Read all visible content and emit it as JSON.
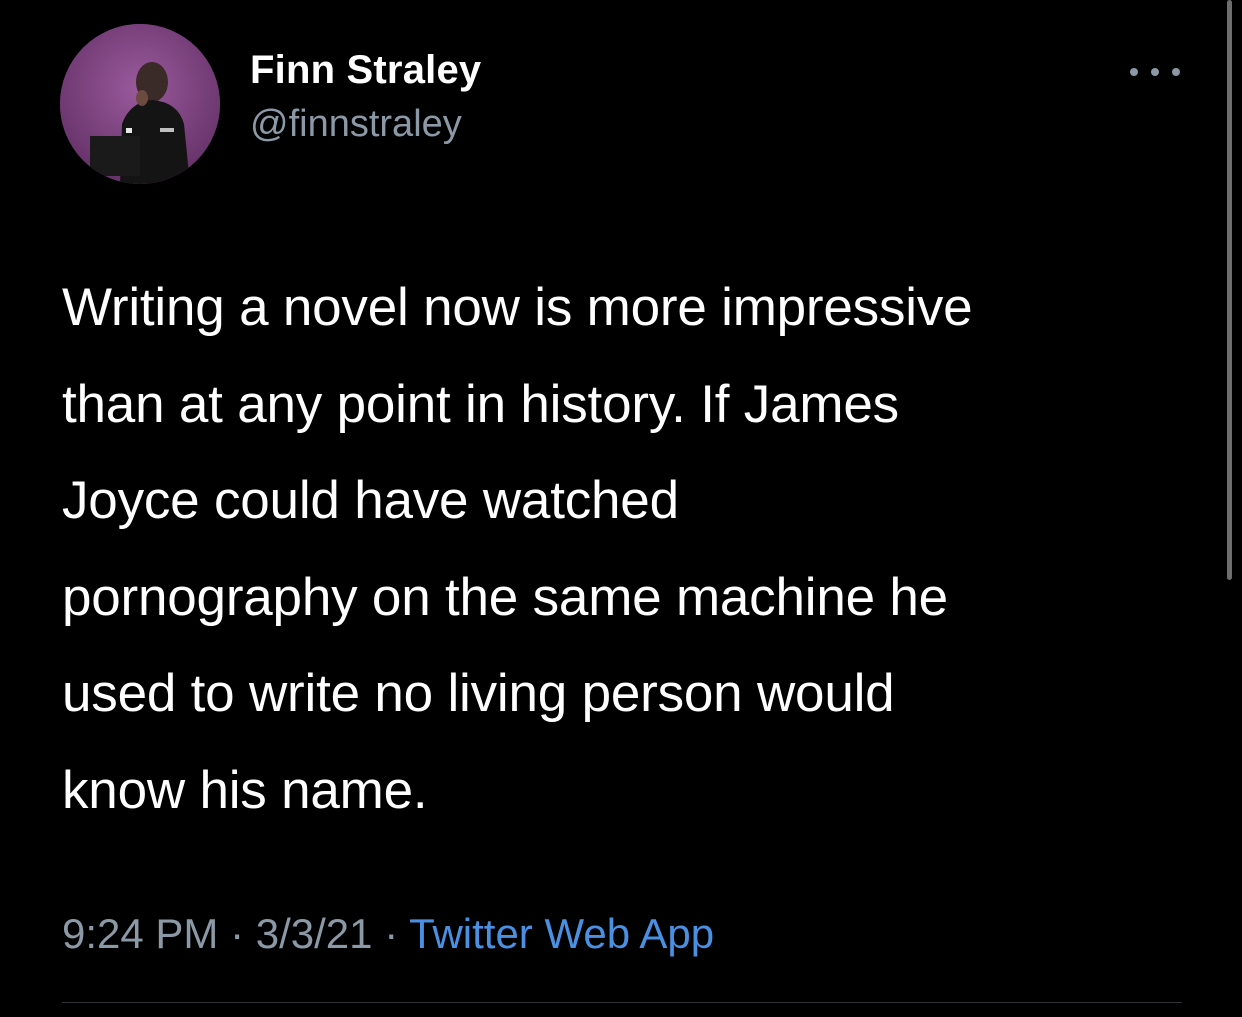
{
  "tweet": {
    "display_name": "Finn Straley",
    "handle": "@finnstraley",
    "body_lines": [
      "Writing a novel now is more impressive",
      "than at any point in history. If James",
      "Joyce could have watched",
      "pornography on the same machine he",
      "used to write no living person would",
      "know his name."
    ],
    "time": "9:24 PM",
    "separator": "·",
    "date": "3/3/21",
    "source_app": "Twitter Web App",
    "avatar_icon": "profile-photo-icon",
    "more_icon": "more-options-icon"
  },
  "colors": {
    "background": "#000000",
    "text_primary": "#ffffff",
    "text_secondary": "#8b98a5",
    "link": "#4a90e2",
    "avatar_bg": "#7a3f7e"
  }
}
